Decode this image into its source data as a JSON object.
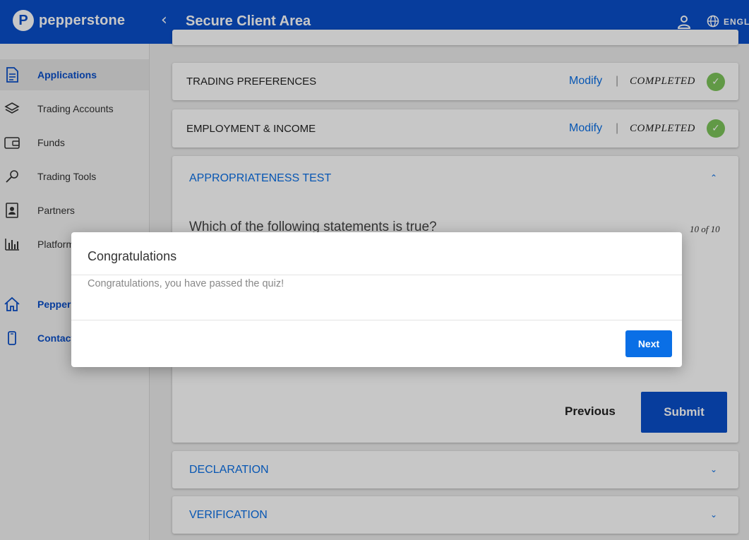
{
  "header": {
    "logo_text": "pepperstone",
    "logo_mark": "P",
    "back_icon": "chevron-left-icon",
    "title": "Secure Client Area",
    "language": "ENGLISH",
    "color": "#0a4fc9"
  },
  "sidebar": {
    "items": [
      {
        "label": "Applications",
        "icon": "document-icon",
        "active": true
      },
      {
        "label": "Trading Accounts",
        "icon": "layers-icon"
      },
      {
        "label": "Funds",
        "icon": "wallet-icon"
      },
      {
        "label": "Trading Tools",
        "icon": "key-icon"
      },
      {
        "label": "Partners",
        "icon": "contact-card-icon"
      },
      {
        "label": "Platforms",
        "icon": "bar-chart-icon"
      },
      {
        "label": "Pepperstone",
        "icon": "home-icon"
      },
      {
        "label": "Contact",
        "icon": "phone-icon"
      }
    ]
  },
  "sections": {
    "trading_preferences": {
      "title": "TRADING PREFERENCES",
      "action": "Modify",
      "separator": "|",
      "status": "COMPLETED"
    },
    "employment_income": {
      "title": "EMPLOYMENT & INCOME",
      "action": "Modify",
      "separator": "|",
      "status": "COMPLETED"
    },
    "appropriateness_test": {
      "title": "APPROPRIATENESS TEST",
      "question": "Which of the following statements is true?",
      "progress": "10 of 10",
      "previous_label": "Previous",
      "submit_label": "Submit"
    },
    "declaration": {
      "title": "DECLARATION"
    },
    "verification": {
      "title": "VERIFICATION"
    }
  },
  "modal": {
    "title": "Congratulations",
    "message": "Congratulations, you have passed the quiz!",
    "next_label": "Next"
  },
  "colors": {
    "accent": "#0a6fe6",
    "brand": "#0a4fc9",
    "success": "#7dc45a"
  }
}
